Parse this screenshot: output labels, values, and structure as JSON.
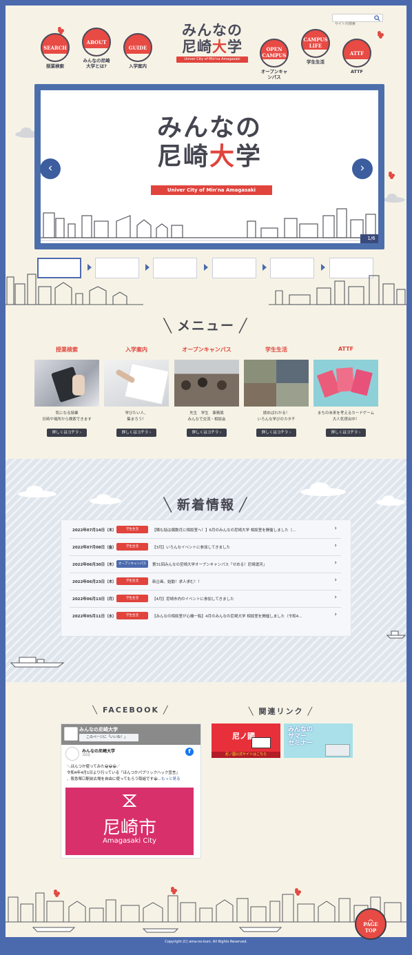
{
  "search": {
    "placeholder": "サイト内検索"
  },
  "logo": {
    "line1": "みんなの",
    "line2a": "尼崎",
    "line2b": "大",
    "line2c": "学",
    "tagline": "Univer City of Min'na Amagasaki"
  },
  "nav": [
    {
      "en": "SEARCH",
      "jp": "授業検索"
    },
    {
      "en": "ABOUT",
      "jp": "みんなの尼崎大学とは?"
    },
    {
      "en": "GUIDE",
      "jp": "入学案内"
    },
    {
      "en": "OPEN CAMPUS",
      "jp": "オープンキャンパス"
    },
    {
      "en": "CAMPUS LIFE",
      "jp": "学生生活"
    },
    {
      "en": "ATTF",
      "jp": "ATTF"
    }
  ],
  "slider": {
    "title_a": "みんなの",
    "title_b1": "尼崎",
    "title_b2": "大",
    "title_b3": "学",
    "band": "Univer City of Min'na Amagasaki",
    "counter": "1/6",
    "prev": "‹",
    "next": "›"
  },
  "menu": {
    "title": "メニュー",
    "items": [
      {
        "heading": "授業検索",
        "desc1": "気になる授業",
        "desc2": "日時や場所から検索できます",
        "btn": "詳しくはコチラ ›"
      },
      {
        "heading": "入学案内",
        "desc1": "学びたい人、",
        "desc2": "集まろう！",
        "btn": "詳しくはコチラ ›"
      },
      {
        "heading": "オープンキャンパス",
        "desc1": "先生　学生　事務局",
        "desc2": "みんなで交流・相談会",
        "btn": "詳しくはコチラ ›"
      },
      {
        "heading": "学生生活",
        "desc1": "読めばわかる！",
        "desc2": "いろんな学びのカタチ",
        "btn": "詳しくはコチラ ›"
      },
      {
        "heading": "ATTF",
        "desc1": "まちの未来を考えるカードゲーム",
        "desc2": "大人気貸出中！",
        "btn": "詳しくはコチラ ›"
      }
    ]
  },
  "news": {
    "title": "新着情報",
    "rows": [
      {
        "date": "2022年07月14日（木）",
        "tag": "学生生活",
        "title": "【隣も話は偶数月に相談室へ！】6月のみんなの尼崎大学 相談室を開催しました（..."
      },
      {
        "date": "2022年07月08日（金）",
        "tag": "学生生活",
        "title": "【3月】いろんなイベントに参加してきました"
      },
      {
        "date": "2022年06月30日（木）",
        "tag": "オープンキャンパス",
        "title": "第31回みんなの尼崎大学オープンキャンパス「せめる！尼崎運河」"
      },
      {
        "date": "2022年06月23日（木）",
        "tag": "学生生活",
        "title": "新企画、始動！求人求む！！"
      },
      {
        "date": "2022年06月13日（月）",
        "tag": "学生生活",
        "title": "【4月】尼崎市内のイベントに参加してきました"
      },
      {
        "date": "2022年05月11日（水）",
        "tag": "学生生活",
        "title": "【みんなの相談室が心機一転】4月のみんなの尼崎大学 相談室を開催しました（令和4..."
      }
    ]
  },
  "facebook": {
    "title": "FACEBOOK",
    "page_name": "みんなの尼崎大学",
    "like_label": "このページに「いいね！」",
    "post_name": "みんなの尼崎大学",
    "post_time": "3日前",
    "post_line1": "＼ほんつか使ってみた😀😀😀／",
    "post_line2": "令和4年4月1日より行っている「ほんつかパブリックハック宣言」",
    "post_line3": "、阪急塚口駅前広場を自由に使ってもらう取組です😀...",
    "more": "もっと見る",
    "img_city": "尼崎市",
    "img_city_en": "Amagasaki City",
    "fb_icon": "f"
  },
  "links": {
    "title": "関連リンク",
    "b1_title": "尼ノ國",
    "b1_sub": "尼ノ國公式サイトはこちら",
    "b2_line1": "みんなの",
    "b2_line2": "サマー",
    "b2_line3": "セミナー"
  },
  "pagetop": {
    "line1": "PAGE",
    "line2": "TOP"
  },
  "copyright": "Copyright (C) ama-no-kuni. All Rights Reserved.",
  "colors": {
    "accent": "#e0443d",
    "navy": "#4b6aae",
    "dark": "#3b3e48",
    "open_campus_tag": "#4b6aae"
  }
}
